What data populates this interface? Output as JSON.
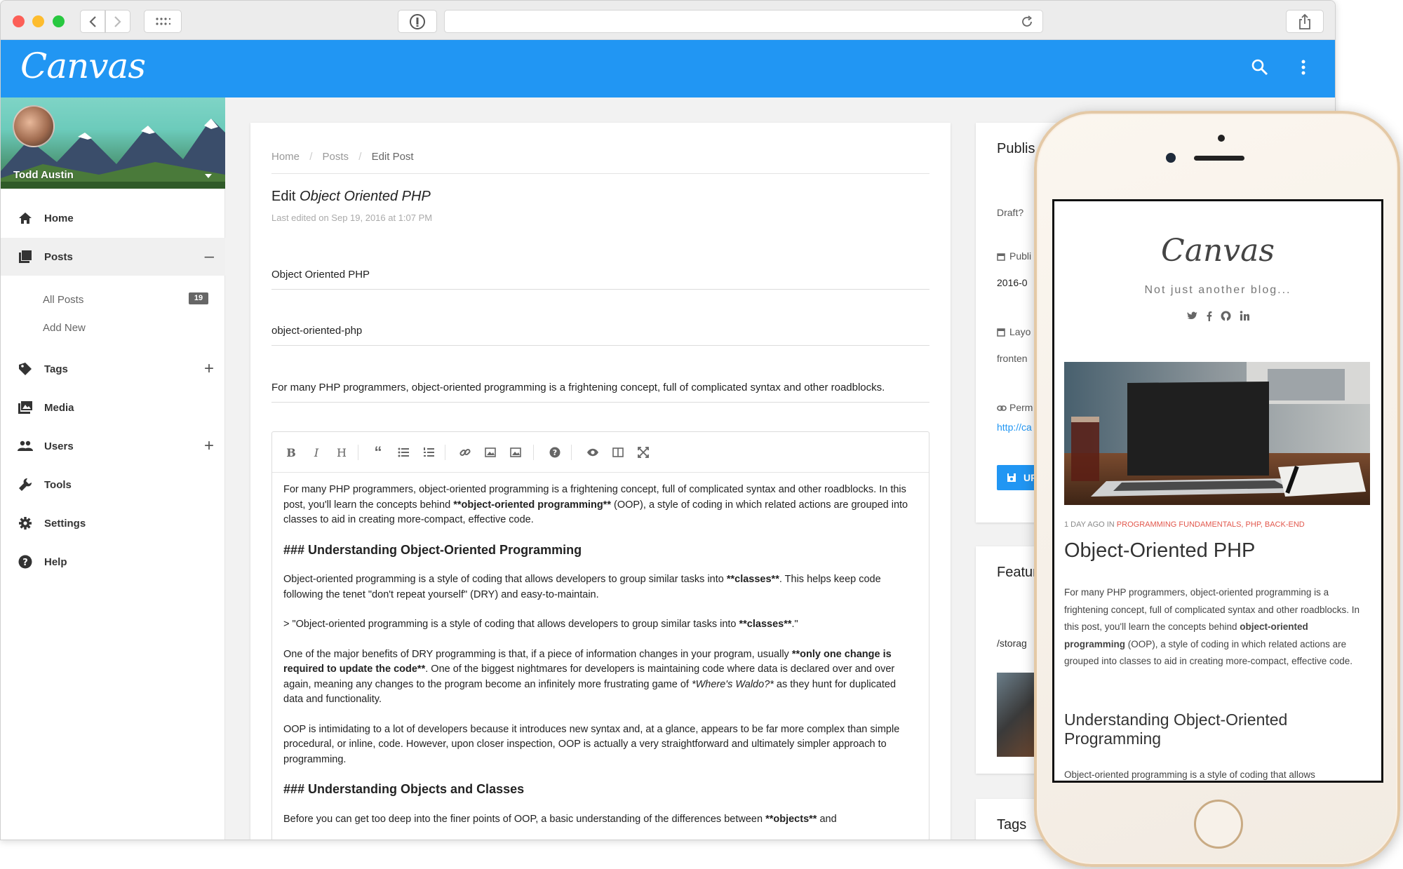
{
  "app": {
    "logo_text": "Canvas"
  },
  "user": {
    "name": "Todd Austin"
  },
  "sidebar": {
    "items": [
      {
        "label": "Home",
        "icon": "home-icon"
      },
      {
        "label": "Posts",
        "icon": "posts-icon",
        "action": "–"
      },
      {
        "label": "Tags",
        "icon": "tags-icon",
        "action": "+"
      },
      {
        "label": "Media",
        "icon": "media-icon"
      },
      {
        "label": "Users",
        "icon": "users-icon",
        "action": "+"
      },
      {
        "label": "Tools",
        "icon": "wrench-icon"
      },
      {
        "label": "Settings",
        "icon": "gear-icon"
      },
      {
        "label": "Help",
        "icon": "help-icon"
      }
    ],
    "posts_sub": [
      {
        "label": "All Posts",
        "count": "19"
      },
      {
        "label": "Add New"
      }
    ]
  },
  "main": {
    "breadcrumb": [
      "Home",
      "/",
      "Posts",
      "/",
      "Edit Post"
    ],
    "edit_prefix": "Edit",
    "edit_title": "Object Oriented PHP",
    "last_edited": "Last edited on Sep 19, 2016 at 1:07 PM",
    "title_value": "Object Oriented PHP",
    "slug_value": "object-oriented-php",
    "subtitle_value": "For many PHP programmers, object-oriented programming is a frightening concept, full of complicated syntax and other roadblocks.",
    "editor": {
      "p1a": "For many PHP programmers, object-oriented programming is a frightening concept, full of complicated syntax and other roadblocks. In this post, you'll learn the concepts behind ",
      "p1b": "**object-oriented programming**",
      "p1c": " (OOP), a style of coding in which related actions are grouped into classes to aid in creating more-compact, effective code.",
      "h1": "### Understanding Object-Oriented Programming",
      "p2a": "Object-oriented programming is a style of coding that allows developers to group similar tasks into ",
      "p2b": "**classes**",
      "p2c": ". This helps keep code following the tenet \"don't repeat yourself\" (DRY) and easy-to-maintain.",
      "p3a": "> \"Object-oriented programming is a style of coding that allows developers to group similar tasks into ",
      "p3b": "**classes**",
      "p3c": ".\"",
      "p4a": "One of the major benefits of DRY programming is that, if a piece of information changes in your program, usually ",
      "p4b": "**only one change is required to update the code**",
      "p4c": ". One of the biggest nightmares for developers is maintaining code where data is declared over and over again, meaning any changes to the program become an infinitely more frustrating game of ",
      "p4d": "*Where's Waldo?*",
      "p4e": " as they hunt for duplicated data and functionality.",
      "p5": "OOP is intimidating to a lot of developers because it introduces new syntax and, at a glance, appears to be far more complex than simple procedural, or inline, code. However, upon closer inspection, OOP is actually a very straightforward and ultimately simpler approach to programming.",
      "h2": "### Understanding Objects and Classes",
      "p6a": "Before you can get too deep into the finer points of OOP, a basic understanding of the differences between ",
      "p6b": "**objects**",
      "p6c": " and"
    }
  },
  "publish": {
    "title": "Publis",
    "draft_label": "Draft?",
    "pub_label": "Publi",
    "pub_value": "2016-0",
    "layout_label": "Layo",
    "layout_value": "fronten",
    "perm_label": "Perm",
    "perm_value": "http://ca",
    "update_label": "UP"
  },
  "featured": {
    "title": "Featur",
    "path": "/storag"
  },
  "tags_card": {
    "title": "Tags"
  },
  "mobile": {
    "logo": "Canvas",
    "tagline": "Not just another blog...",
    "meta_prefix": "1 DAY AGO IN ",
    "meta_categories": "PROGRAMMING FUNDAMENTALS, PHP, BACK-END",
    "title": "Object-Oriented PHP",
    "excerpt_a": "For many PHP programmers, object-oriented programming is a frightening concept, full of complicated syntax and other roadblocks. In this post, you'll learn the concepts behind ",
    "excerpt_b": "object-oriented programming",
    "excerpt_c": " (OOP), a style of coding in which related actions are grouped into classes to aid in creating more-compact, effective code.",
    "h2": "Understanding Object-Oriented Programming",
    "para": "Object-oriented programming is a style of coding that allows"
  },
  "colors": {
    "accent": "#2196f3",
    "category": "#e2574c"
  }
}
